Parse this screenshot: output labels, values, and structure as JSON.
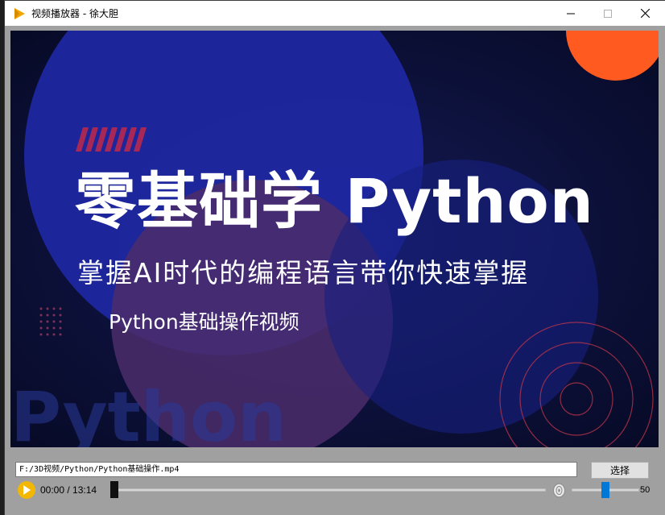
{
  "window": {
    "title": "视频播放器 - 徐大胆"
  },
  "video_frame": {
    "headline": "零基础学 Python",
    "subheadline": "掌握AI时代的编程语言带你快速掌握",
    "caption": "Python基础操作视频",
    "watermark_text": "Python",
    "colors": {
      "background": "#0c1035",
      "blue_circle": "#2028a0",
      "orange_circle": "#ff5a1f",
      "purple_circle": "#4a2a6a",
      "stripe_accent": "#c0294a"
    }
  },
  "controls": {
    "file_path": "F:/3D视频/Python/Python基础操作.mp4",
    "select_button_label": "选择",
    "time_display": "00:00 / 13:14",
    "playback_progress": 0.0,
    "volume": 50,
    "volume_max": 100,
    "volume_label": "50",
    "accent_color": "#f2b705",
    "slider_color": "#0078d7"
  },
  "icons": {
    "app": "play-triangle-icon",
    "minimize": "minimize-icon",
    "maximize": "maximize-icon",
    "close": "close-icon",
    "play": "play-icon",
    "volume": "volume-icon"
  }
}
